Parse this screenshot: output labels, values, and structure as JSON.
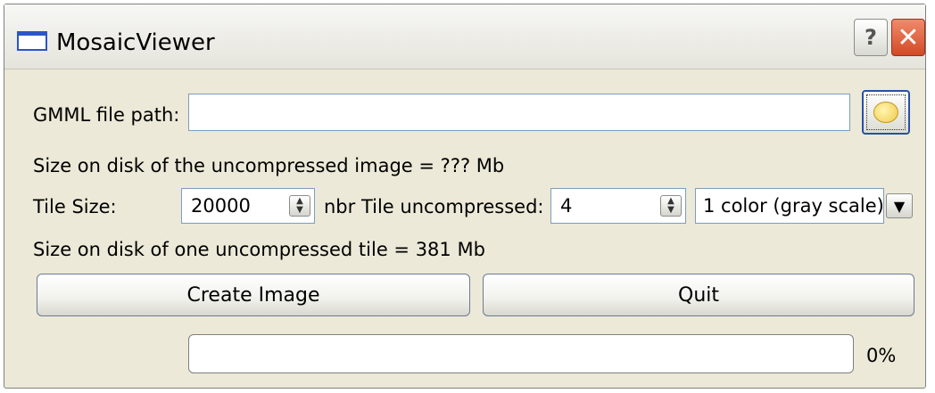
{
  "window": {
    "title": "MosaicViewer"
  },
  "titlebar": {
    "help_label": "?",
    "close_label": "✕"
  },
  "gmml": {
    "label": "GMML file path:",
    "value": ""
  },
  "size_uncompressed_text": "Size on disk of the uncompressed image = ??? Mb",
  "tile": {
    "size_label": "Tile Size:",
    "size_value": "20000",
    "nbr_label": "nbr Tile uncompressed:",
    "nbr_value": "4",
    "color_selected": "1 color (gray scale)"
  },
  "size_tile_text": "Size on disk of one uncompressed tile = 381 Mb",
  "buttons": {
    "create": "Create Image",
    "quit": "Quit"
  },
  "progress": {
    "value": 0,
    "text": "0%"
  },
  "icons": {
    "app": "window-icon",
    "browse": "folder-icon",
    "help": "help-icon",
    "close": "close-icon",
    "dropdown": "chevron-down-icon"
  }
}
